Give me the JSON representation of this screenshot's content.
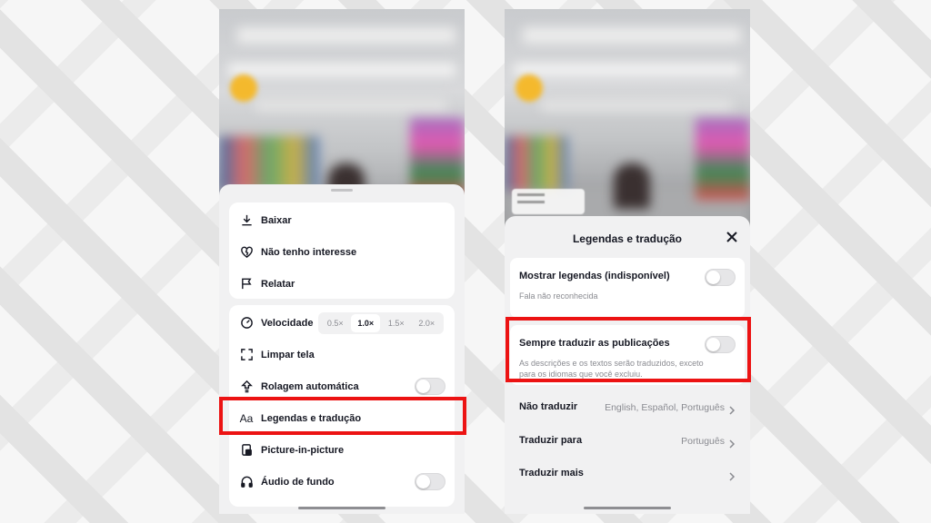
{
  "left_menu": {
    "group1": [
      {
        "label": "Baixar",
        "icon": "download-icon"
      },
      {
        "label": "Não tenho interesse",
        "icon": "broken-heart-icon"
      },
      {
        "label": "Relatar",
        "icon": "flag-icon"
      }
    ],
    "speed": {
      "label": "Velocidade",
      "icon": "speedometer-icon",
      "options": [
        "0.5×",
        "1.0×",
        "1.5×",
        "2.0×"
      ],
      "selected": "1.0×"
    },
    "clear_screen": {
      "label": "Limpar tela",
      "icon": "fullscreen-icon"
    },
    "autoscroll": {
      "label": "Rolagem automática",
      "icon": "scroll-up-icon",
      "on": false
    },
    "captions": {
      "label": "Legendas e tradução",
      "icon": "text-aa-icon"
    },
    "pip": {
      "label": "Picture-in-picture",
      "icon": "pip-icon"
    },
    "background_audio": {
      "label": "Áudio de fundo",
      "icon": "headphones-icon",
      "on": false
    }
  },
  "right_panel": {
    "title": "Legendas e tradução",
    "show_captions": {
      "title": "Mostrar legendas (indisponível)",
      "desc": "Fala não reconhecida",
      "on": false
    },
    "always_translate": {
      "title": "Sempre traduzir as publicações",
      "desc_line1": "As descrições e os textos serão traduzidos, exceto",
      "desc_line2": "para os idiomas que você excluiu.",
      "on": false
    },
    "dont_translate": {
      "title": "Não traduzir",
      "value": "English, Español, Português"
    },
    "translate_to": {
      "title": "Traduzir para",
      "value": "Português"
    },
    "translate_more": {
      "title": "Traduzir mais"
    }
  },
  "colors": {
    "highlight": "#ec1313",
    "text": "#161823",
    "muted": "#8a8b91",
    "sheet": "#f1f1f2"
  }
}
